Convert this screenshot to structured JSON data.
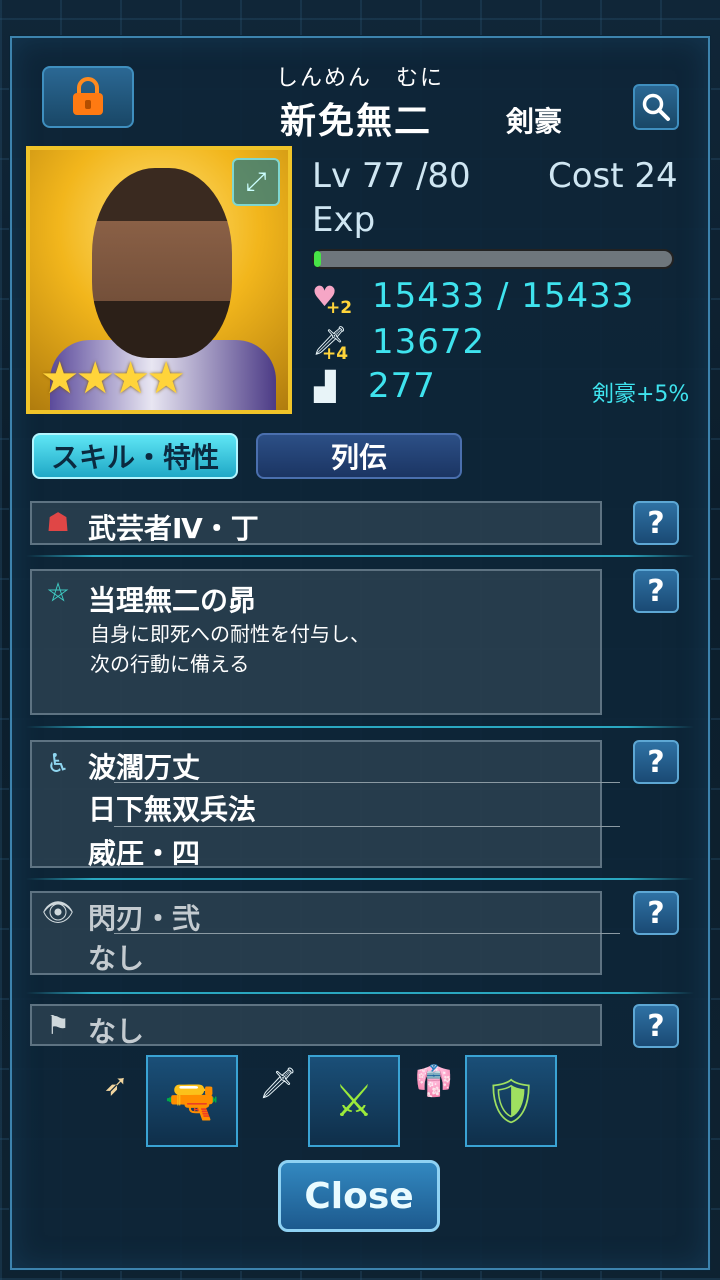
{
  "header": {
    "kana": "しんめん　むに",
    "name": "新免無二",
    "class": "剣豪",
    "lock_icon": "lock-icon",
    "search_icon": "search-icon"
  },
  "portrait": {
    "stars": "★★★★",
    "star_count": 4,
    "expand_icon": "expand-icon"
  },
  "stats": {
    "level_label": "Lv",
    "level": "77",
    "level_max": "/80",
    "cost_label": "Cost",
    "cost": "24",
    "exp_label": "Exp",
    "exp_fraction": 0.02,
    "hp_bonus": "+2",
    "hp": "15433 / 15433",
    "atk_bonus": "+4",
    "atk": "13672",
    "speed": "277",
    "class_bonus": "剣豪+5%"
  },
  "tabs": [
    {
      "label": "スキル・特性"
    },
    {
      "label": "列伝"
    }
  ],
  "slots": {
    "class_trait": {
      "title": "武芸者Ⅳ・丁"
    },
    "skill": {
      "title": "当理無二の昴",
      "desc1": "自身に即死への耐性を付与し、",
      "desc2": "次の行動に備える"
    },
    "passives": [
      "波濶万丈",
      "日下無双兵法",
      "威圧・四"
    ],
    "awaken": [
      "閃刃・弐",
      "なし"
    ],
    "flag": "なし",
    "help_label": "?"
  },
  "equipment": {
    "gun": "handgun",
    "blade": "crossed-swords",
    "armor": "armor"
  },
  "close_label": "Close",
  "colors": {
    "accent": "#3fe3ee",
    "gold": "#f0c429",
    "exp_fill": "#47e447"
  }
}
